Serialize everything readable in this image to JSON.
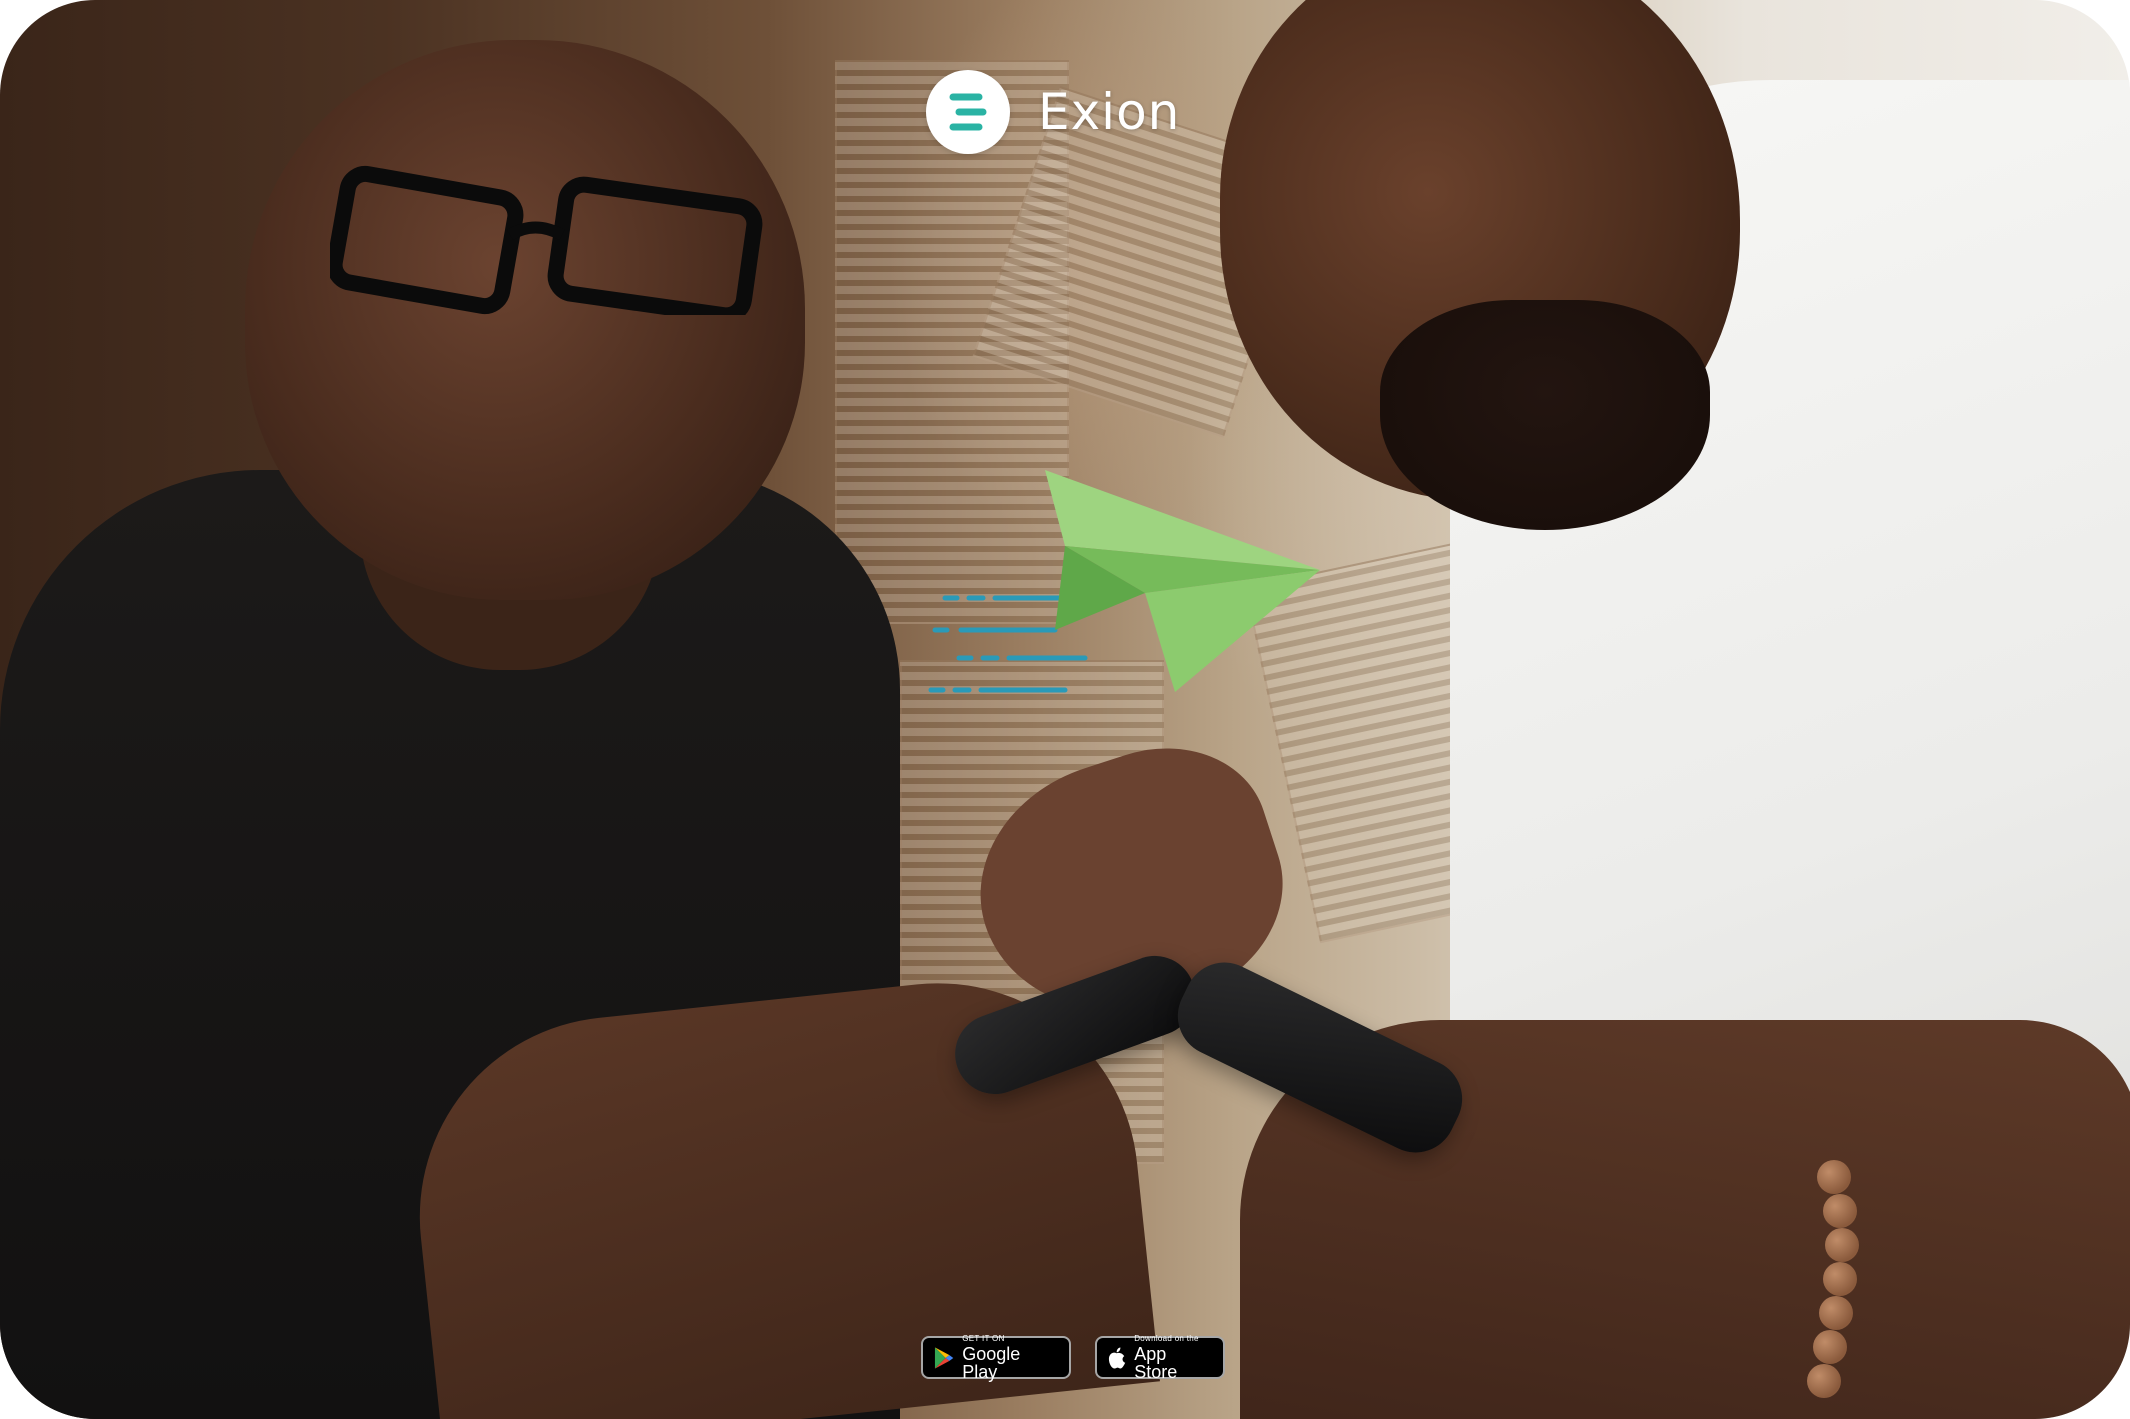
{
  "brand": {
    "name": "Exion",
    "logo_icon": "exion-logo-icon",
    "accent_color": "#2ab3a4"
  },
  "hero": {
    "photo": "two-men-using-smartphones-photo",
    "plane_icon": "paper-plane-icon",
    "plane_color": "#8ccb6e",
    "speed_lines_color": "#2a9ab8"
  },
  "stores": {
    "google_play": {
      "small": "GET IT ON",
      "big": "Google Play",
      "icon": "google-play-icon"
    },
    "app_store": {
      "small": "Download on the",
      "big": "App Store",
      "icon": "apple-icon"
    }
  }
}
